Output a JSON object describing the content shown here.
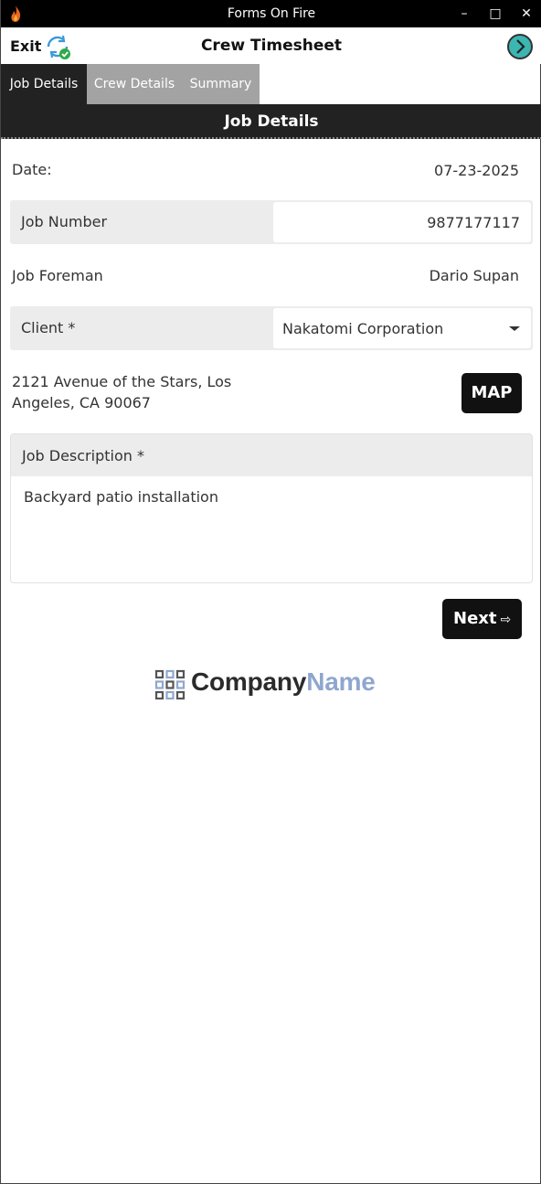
{
  "window": {
    "title": "Forms On Fire",
    "controls": {
      "minimize": "–",
      "maximize": "□",
      "close": "✕"
    }
  },
  "header": {
    "exit_label": "Exit",
    "title": "Crew Timesheet"
  },
  "tabs": [
    {
      "label": "Job Details",
      "active": true
    },
    {
      "label": "Crew Details",
      "active": false
    },
    {
      "label": "Summary",
      "active": false
    }
  ],
  "section": {
    "title": "Job Details"
  },
  "form": {
    "date": {
      "label": "Date:",
      "value": "07-23-2025"
    },
    "job_number": {
      "label": "Job Number",
      "value": "9877177117"
    },
    "job_foreman": {
      "label": "Job Foreman",
      "value": "Dario Supan"
    },
    "client": {
      "label": "Client *",
      "value": "Nakatomi Corporation"
    },
    "address": "2121 Avenue of the Stars, Los Angeles, CA 90067",
    "map_label": "MAP",
    "job_description": {
      "label": "Job Description *",
      "value": "Backyard patio installation"
    },
    "next_label": "Next",
    "next_arrow": "⇨"
  },
  "logo": {
    "part1": "Company",
    "part2": "Name"
  },
  "colors": {
    "titlebar": "#000000",
    "active_tab": "#222222",
    "inactive_tab": "#a3a3a3",
    "field_bg": "#ececec",
    "accent_teal": "#3cb6b0",
    "logo_blue": "#8fa7cf"
  }
}
